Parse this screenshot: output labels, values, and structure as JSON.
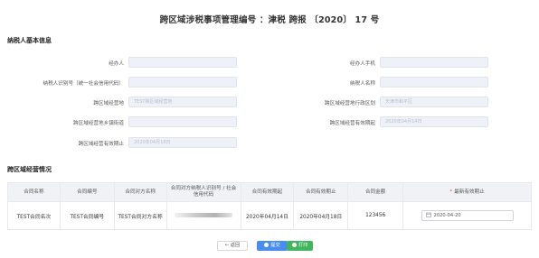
{
  "title": "跨区域涉税事项管理编号 ：津税 跨报 〔2020〕 17 号",
  "taxpayer_section": {
    "title": "纳税人基本信息",
    "fields": {
      "handler": {
        "label": "经办人",
        "value": ""
      },
      "handler_phone": {
        "label": "经办人手机",
        "value": ""
      },
      "taxpayer_id": {
        "label": "纳税人识别号（统一社会信用代码）",
        "value": ""
      },
      "taxpayer_name": {
        "label": "纳税人名称",
        "value": ""
      },
      "address": {
        "label": "跨区域经营地",
        "value": "TEST跨区域经营地"
      },
      "admin_region": {
        "label": "跨区域经营地行政区划",
        "value": "天津市和平区"
      },
      "street": {
        "label": "跨区域经营地乡镇街道",
        "value": ""
      },
      "valid_start": {
        "label": "跨区域经营有效期起",
        "value": "2020年04月14日"
      },
      "valid_end": {
        "label": "跨区域经营有效期止",
        "value": "2020年04月18日"
      }
    }
  },
  "business_section": {
    "title": "跨区域经营情况",
    "columns": [
      "合同名称",
      "合同编号",
      "合同对方名称",
      "合同对方纳税人识别号 / 社会信用代码",
      "合同有效期起",
      "合同有效期止",
      "合同金额",
      "最新有效期止"
    ],
    "required_mark": "*",
    "row": {
      "contract_name": "TEST合同名次",
      "contract_no": "TEST合同编号",
      "counterparty_name": "TEST合同对方名称",
      "counterparty_id": "",
      "valid_start": "2020年04月14日",
      "valid_end": "2020年04月18日",
      "amount": "123456",
      "new_valid_end": "2020-04-20"
    }
  },
  "buttons": {
    "return": "← 返回",
    "submit": "提交",
    "print": "打印"
  },
  "colors": {
    "primary": "#4a8df0",
    "success": "#44b55f",
    "required": "#e5474b",
    "field_bg": "#eef1f8"
  }
}
